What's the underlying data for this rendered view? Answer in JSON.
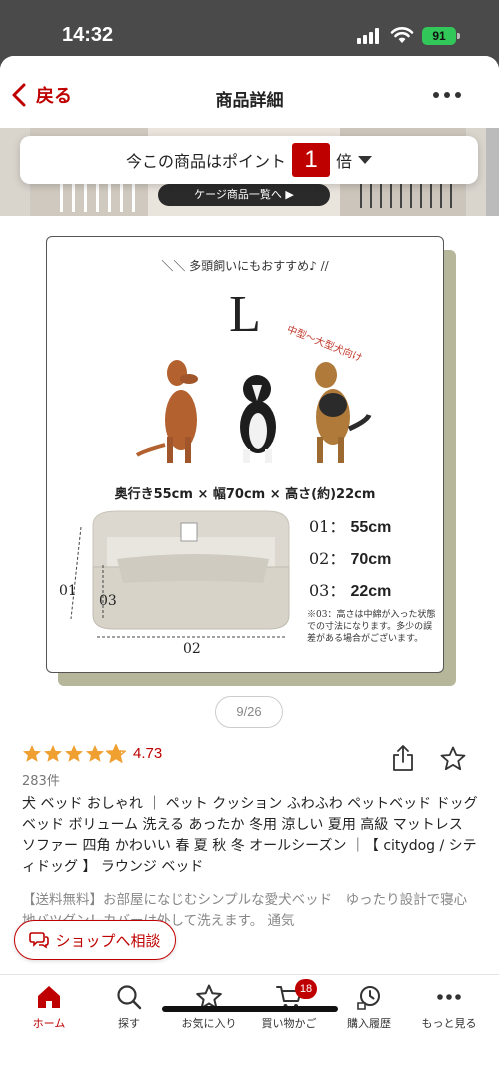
{
  "status_bar": {
    "time": "14:32",
    "battery": "91"
  },
  "header": {
    "back_label": "戻る",
    "title": "商品詳細"
  },
  "banner": {
    "cage_button_label": "ケージ商品一覧へ ▶"
  },
  "points": {
    "prefix": "今この商品はポイント",
    "multiplier": "1",
    "suffix": "倍"
  },
  "product_image": {
    "tagline": "＼＼ 多頭飼いにもおすすめ♪ //",
    "size_letter": "L",
    "dog_tag": "中型〜大型犬向け",
    "dimensions": "奥行き55cm × 幅70cm × 高さ(約)22cm",
    "measurements": [
      {
        "code": "01：",
        "value": "55cm"
      },
      {
        "code": "02：",
        "value": "70cm"
      },
      {
        "code": "03：",
        "value": "22cm"
      }
    ],
    "bed_labels": {
      "l01": "01",
      "l02": "02",
      "l03": "03"
    },
    "footnote": "※03：高さは中綿が入った状態での寸法になります。多少の誤差がある場合がございます。",
    "counter": "9/26"
  },
  "product": {
    "rating": "4.73",
    "rating_fraction": 0.946,
    "review_count": "283件",
    "title": "犬 ベッド おしゃれ ｜ ペット クッション ふわふわ ペットベッド ドッグベッド ボリューム 洗える あったか 冬用 涼しい 夏用 高級 マットレス ソファー 四角 かわいい 春 夏 秋 冬 オールシーズン ｜【 citydog / シティドッグ 】 ラウンジ ベッド",
    "description": "【送料無料】お部屋になじむシンプルな愛犬ベッド　ゆったり設計で寝心地バツグン！カバーは外して洗えます。 通気"
  },
  "shop_button": {
    "label": "ショップへ相談"
  },
  "tabbar": {
    "home": "ホーム",
    "search": "探す",
    "favorites": "お気に入り",
    "cart": "買い物かご",
    "cart_count": "18",
    "history": "購入履歴",
    "more": "もっと見る"
  },
  "colors": {
    "brand": "#bf0000",
    "star": "#f0a030",
    "olive_shadow": "#b6b69a"
  }
}
